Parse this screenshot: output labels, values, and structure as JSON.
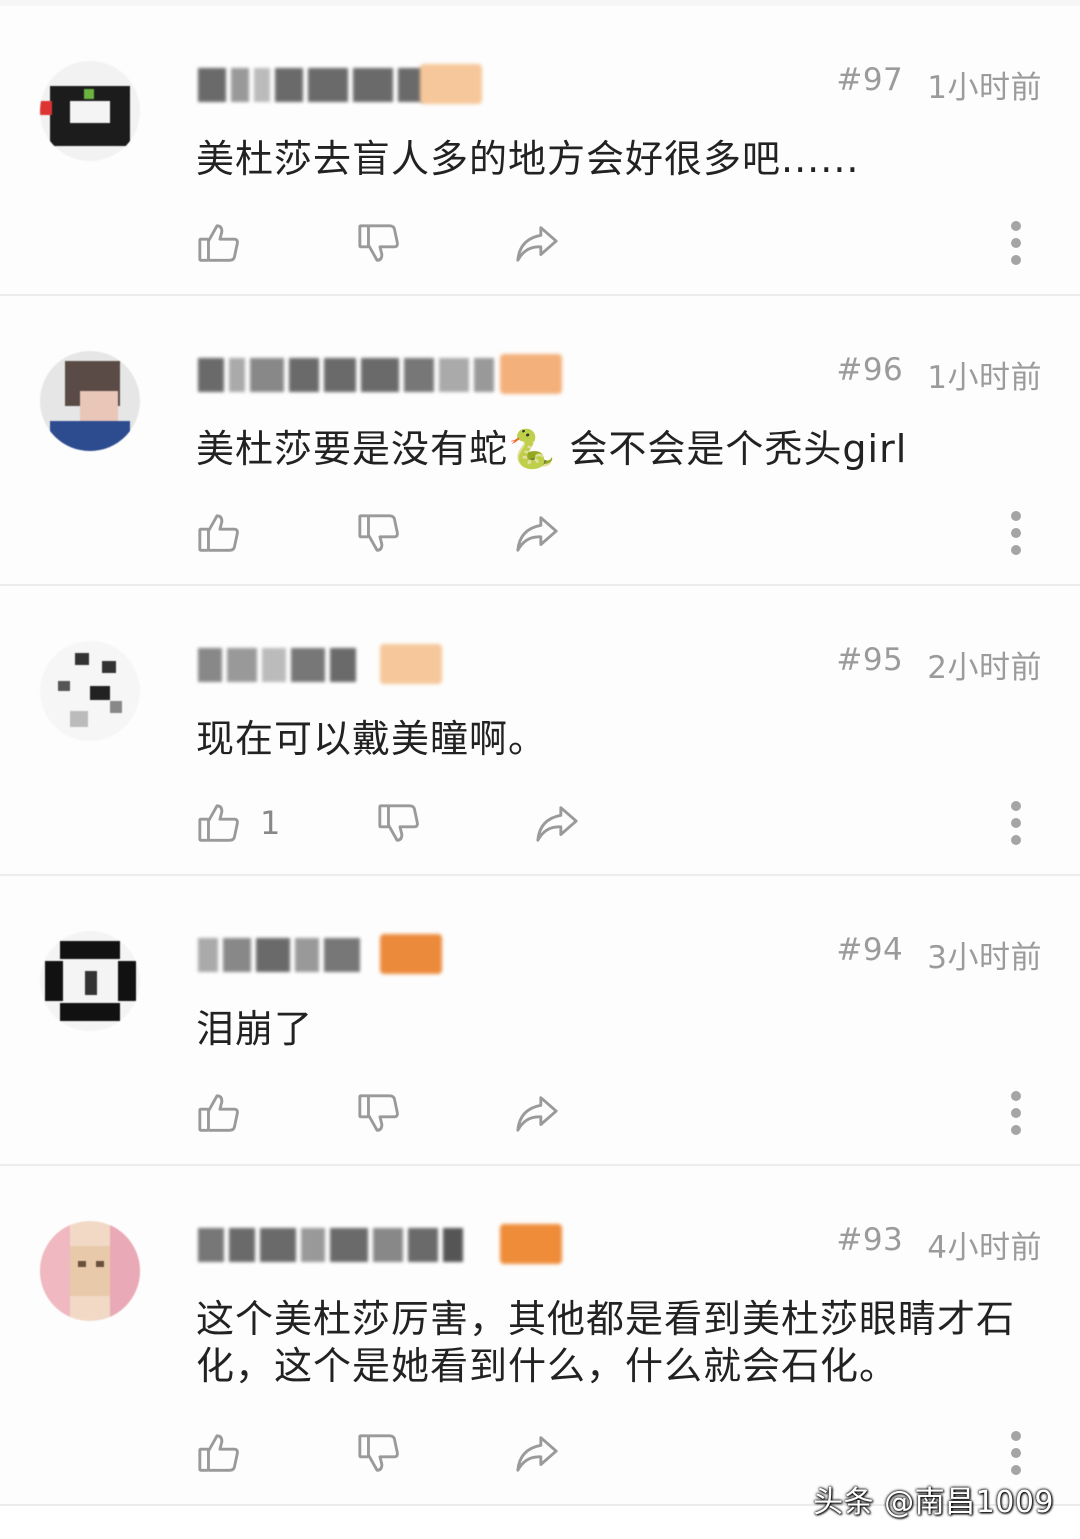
{
  "comments": [
    {
      "floor": "#97",
      "time": "1小时前",
      "text": "美杜莎去盲人多的地方会好很多吧......",
      "like_count": "",
      "badge_color": "#f6c79a"
    },
    {
      "floor": "#96",
      "time": "1小时前",
      "text": "美杜莎要是没有蛇🐍 会不会是个秃头girl",
      "like_count": "",
      "badge_color": "#f4b07a"
    },
    {
      "floor": "#95",
      "time": "2小时前",
      "text": "现在可以戴美瞳啊。",
      "like_count": "1",
      "badge_color": "#f6c79a"
    },
    {
      "floor": "#94",
      "time": "3小时前",
      "text": "泪崩了",
      "like_count": "",
      "badge_color": "#ec8a3c"
    },
    {
      "floor": "#93",
      "time": "4小时前",
      "text": "这个美杜莎厉害，其他都是看到美杜莎眼睛才石化，这个是她看到什么，什么就会石化。",
      "like_count": "",
      "badge_color": "#ee8c3a"
    }
  ],
  "watermark": "头条 @南昌1009",
  "icons": {
    "like": "thumbs-up-icon",
    "dislike": "thumbs-down-icon",
    "share": "share-icon",
    "more": "more-vertical-icon"
  }
}
